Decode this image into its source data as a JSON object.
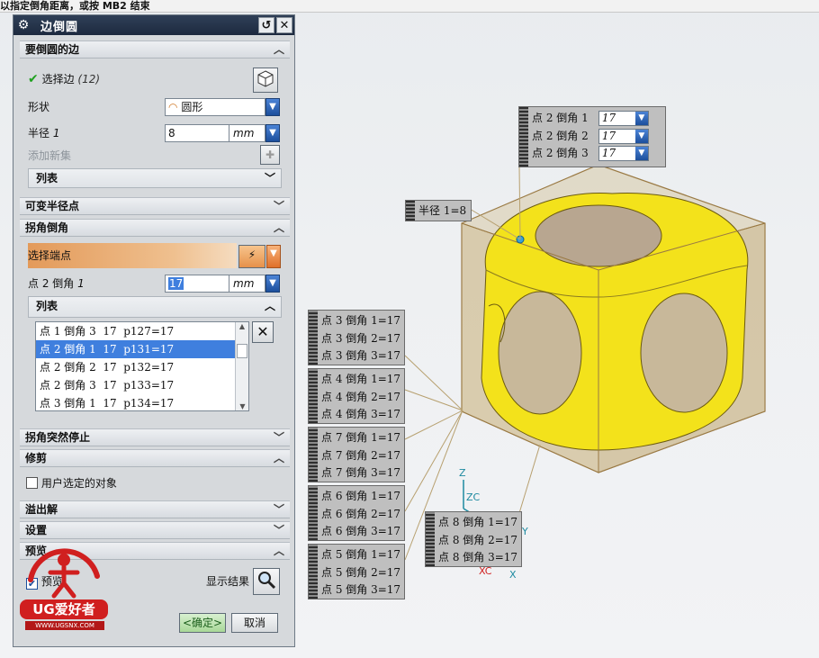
{
  "statusbar": {
    "text": "以指定倒角距离，或按 MB2 结束"
  },
  "dialog": {
    "title": "边倒圆",
    "sections": {
      "edges": "要倒圆的边",
      "variable": "可变半径点",
      "corner": "拐角倒角",
      "corner_stop": "拐角突然停止",
      "trim": "修剪",
      "overflow": "溢出解",
      "settings": "设置",
      "preview": "预览"
    },
    "select_edge": {
      "label": "选择边",
      "count": "(12)"
    },
    "shape": {
      "label": "形状",
      "value": "圆形"
    },
    "radius": {
      "label": "半径",
      "index": "1",
      "value": "8",
      "unit": "mm"
    },
    "add_set": "添加新集",
    "list_label": "列表",
    "select_endpoint": "选择端点",
    "point_chamfer": {
      "label": "点 2 倒角",
      "index": "1",
      "value": "17",
      "unit": "mm"
    },
    "list_items": [
      "点 1 倒角 3  17  p127=17",
      "点 2 倒角 1  17  p131=17",
      "点 2 倒角 2  17  p132=17",
      "点 2 倒角 3  17  p133=17",
      "点 3 倒角 1  17  p134=17"
    ],
    "selected_index": 1,
    "trim_checkbox": "用户选定的对象",
    "preview_checkbox": "预览",
    "show_result": "显示结果",
    "ok": "<确定>",
    "cancel": "取消"
  },
  "viewport": {
    "radius_label": "半径 1=8",
    "top_callout": [
      {
        "label": "点 2 倒角 1",
        "value": "17"
      },
      {
        "label": "点 2 倒角 2",
        "value": "17"
      },
      {
        "label": "点 2 倒角 3",
        "value": "17"
      }
    ],
    "left_callouts": [
      [
        "点 3 倒角 1=17",
        "点 3 倒角 2=17",
        "点 3 倒角 3=17"
      ],
      [
        "点 4 倒角 1=17",
        "点 4 倒角 2=17",
        "点 4 倒角 3=17"
      ],
      [
        "点 7 倒角 1=17",
        "点 7 倒角 2=17",
        "点 7 倒角 3=17"
      ],
      [
        "点 6 倒角 1=17",
        "点 6 倒角 2=17",
        "点 6 倒角 3=17"
      ],
      [
        "点 5 倒角 1=17",
        "点 5 倒角 2=17",
        "点 5 倒角 3=17"
      ]
    ],
    "bottom_callout": [
      "点 8 倒角 1=17",
      "点 8 倒角 2=17",
      "点 8 倒角 3=17"
    ],
    "axes": {
      "z": "Z",
      "zc": "ZC",
      "y": "Y",
      "xc": "XC",
      "x": "X"
    }
  },
  "watermark": {
    "brand": "UG爱好者",
    "url": "WWW.UGSNX.COM"
  },
  "colors": {
    "accent_blue": "#3f7fde",
    "part_yellow": "#f3e21b",
    "block_tan": "#c9b48b",
    "title_bar": "#26344b"
  }
}
